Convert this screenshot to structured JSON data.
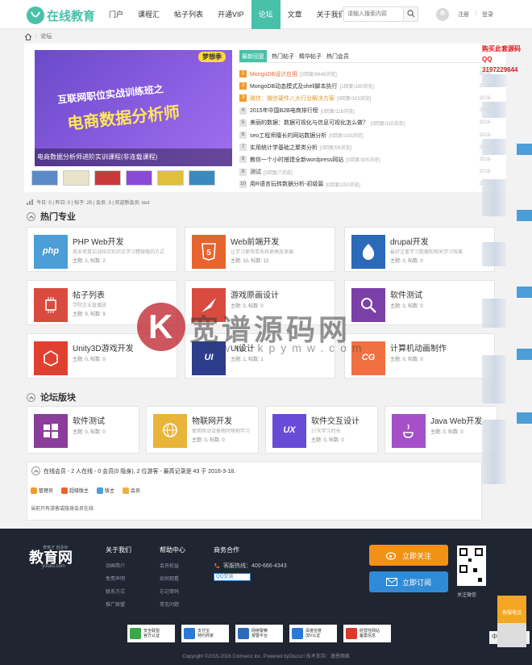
{
  "header": {
    "logo_text": "在线教育",
    "nav": [
      "门户",
      "课程汇",
      "帖子列表",
      "开通VIP",
      "论坛",
      "文章",
      "关于我们"
    ],
    "active_nav": "论坛",
    "search_placeholder": "请输入搜索内容",
    "register": "注册",
    "separator": "|",
    "login": "登录",
    "accent": "#47c1a8"
  },
  "breadcrumb": {
    "label": "论坛"
  },
  "banner": {
    "line1": "互联网职位实战训练班之",
    "line2": "电商数据分析师",
    "tag": "梦想季",
    "caption": "电商数据分析师进阶实训课程(非连载课程)"
  },
  "tabs": [
    "最新回复",
    "热门帖子",
    "精华帖子",
    "热门会员"
  ],
  "hot_list": [
    {
      "n": "1",
      "title": "MongoDB设计应用",
      "meta": "[2回复/6648浏览]",
      "date": "2016-"
    },
    {
      "n": "2",
      "title": "MongoDB动态模式及shell脚本执行",
      "meta": "[1回复/280浏览]",
      "date": "2016-"
    },
    {
      "n": "3",
      "title": "微信：微信硬件八大行业解决方案",
      "meta": "[0回复/103浏览]",
      "date": "2016-"
    },
    {
      "n": "4",
      "title": "2015年中国B2B电商排行榜",
      "meta": "[0回复/116浏览]",
      "date": "2016-"
    },
    {
      "n": "5",
      "title": "美丽的数据：数据可视化与信息可视化怎么做？",
      "meta": "[0回复/110浏览]",
      "date": "2016-"
    },
    {
      "n": "6",
      "title": "seo工程师擅长的网站数据分析",
      "meta": "[0回复/103浏览]",
      "date": "2016-"
    },
    {
      "n": "7",
      "title": "实用统计学基础之聚类分析",
      "meta": "[0回复/59浏览]",
      "date": "2016-"
    },
    {
      "n": "8",
      "title": "教你一个小时搭建全新wordpress网站",
      "meta": "[0回复/305浏览]",
      "date": "2016-"
    },
    {
      "n": "9",
      "title": "测试",
      "meta": "[0回复/7浏览]",
      "date": "2016-"
    },
    {
      "n": "10",
      "title": "用R语言玩转数据分析-初级篇",
      "meta": "[0回复/250浏览]",
      "date": "2016-"
    }
  ],
  "buy_note": {
    "line1": "购买此套源码",
    "line2": "QQ",
    "line3": "3197229644"
  },
  "stats": {
    "text": "今日: 0 | 昨日: 0 | 帖子: 25 | 会员: 3 | 欢迎新会员: test"
  },
  "sections": {
    "hot": "热门专业",
    "forum": "论坛版块"
  },
  "hot_cards": [
    {
      "title": "PHP Web开发",
      "desc": "商业项目实战结合知识点学习精微做的方式",
      "stats": "主题: 2, 帖数: 2",
      "color": "#4b9ed8",
      "icon": "php-icon",
      "label": "php"
    },
    {
      "title": "Web前端开发",
      "desc": "让学习更简单系统更高效发展",
      "stats": "主题: 10, 帖数: 13",
      "color": "#e8642f",
      "icon": "html5-icon",
      "label": ""
    },
    {
      "title": "drupal开发",
      "desc": "最好注重学习数据和相关学习效果",
      "stats": "主题: 0, 帖数: 0",
      "color": "#2a6ab8",
      "icon": "drupal-icon",
      "label": ""
    },
    {
      "title": "帖子列表",
      "desc": "学院企业直播班",
      "stats": "主题: 9, 帖数: 9",
      "color": "#d94b3f",
      "icon": "chip-icon",
      "label": ""
    },
    {
      "title": "游戏原画设计",
      "desc": "",
      "stats": "主题: 0, 帖数: 0",
      "color": "#d94b3f",
      "icon": "brush-icon",
      "label": ""
    },
    {
      "title": "软件测试",
      "desc": "",
      "stats": "主题: 0, 帖数: 0",
      "color": "#7b3fa8",
      "icon": "magnifier-icon",
      "label": ""
    },
    {
      "title": "Unity3D游戏开发",
      "desc": "",
      "stats": "主题: 0, 帖数: 0",
      "color": "#e0402f",
      "icon": "unity-icon",
      "label": ""
    },
    {
      "title": "UI设计",
      "desc": "",
      "stats": "主题: 1, 帖数: 1",
      "color": "#2d3d8c",
      "icon": "ui-icon",
      "label": "UI"
    },
    {
      "title": "计算机动画制作",
      "desc": "",
      "stats": "主题: 0, 帖数: 0",
      "color": "#f07042",
      "icon": "cg-icon",
      "label": "CG"
    }
  ],
  "forum_cards": [
    {
      "title": "软件测试",
      "stats": "主题: 0, 帖数: 0",
      "color": "#8a3d9a",
      "icon": "windows-icon",
      "desc": ""
    },
    {
      "title": "物联网开发",
      "desc": "使用移动设备随时随地学习",
      "stats": "主题: 0, 帖数: 0",
      "color": "#e9b43a",
      "icon": "globe-icon"
    },
    {
      "title": "软件交互设计",
      "desc": "27天学习时长",
      "stats": "主题: 0, 帖数: 0",
      "color": "#6a4bd8",
      "icon": "ux-icon",
      "label": "UX"
    },
    {
      "title": "Java Web开发",
      "desc": "",
      "stats": "主题: 0, 帖数: 0",
      "color": "#a550c8",
      "icon": "java-icon"
    }
  ],
  "online": {
    "heading": "在线会员 - 2 人在线 - 0 会员(0 隐身), 2 位游客 - 最高记录是 43 于 2016-3-18.",
    "legend": [
      {
        "label": "管理员",
        "color": "#f29b2b"
      },
      {
        "label": "超级版主",
        "color": "#e8642f"
      },
      {
        "label": "版主",
        "color": "#4b9ed8"
      },
      {
        "label": "会员",
        "color": "#f0b040"
      }
    ],
    "none": "当前只有游客或隐身会员在线"
  },
  "footer": {
    "logo": "教育网",
    "slogan": "育英才 创造世",
    "domain": "youku.com",
    "col1": {
      "title": "关于我们",
      "items": [
        "动画简介",
        "免责声明",
        "联系方式",
        "推广联盟"
      ]
    },
    "col2": {
      "title": "帮助中心",
      "items": [
        "会员权益",
        "如何观看",
        "忘记密码",
        "常见问题"
      ]
    },
    "biz": {
      "title": "商务合作",
      "hotline": "客服热线：400-666-4343",
      "qq": "QQ交谈"
    },
    "follow": "立即关注",
    "subscribe": "立即订阅",
    "qr_caption": "关注微信",
    "badges": [
      {
        "l1": "安全联盟",
        "l2": "官方认证",
        "color": "#3aa74a"
      },
      {
        "l1": "支付宝",
        "l2": "特约商家",
        "color": "#2a7ad4"
      },
      {
        "l1": "网络警察",
        "l2": "报警平台",
        "color": "#2d6bb8"
      },
      {
        "l1": "百度信誉",
        "l2": "加V认证",
        "color": "#2a7ad4"
      },
      {
        "l1": "经营性网站",
        "l2": "备案信息",
        "color": "#d93a2a"
      }
    ],
    "copyright": "Copyright ©2015-2016 Comsenz Inc. Powered byDiscuz! 技术支持：逸恩网络"
  },
  "watermark": {
    "title": "宽谱源码网",
    "url": "www.kpymw.com"
  },
  "side": {
    "hotline": "客服电话",
    "lang": "中"
  }
}
